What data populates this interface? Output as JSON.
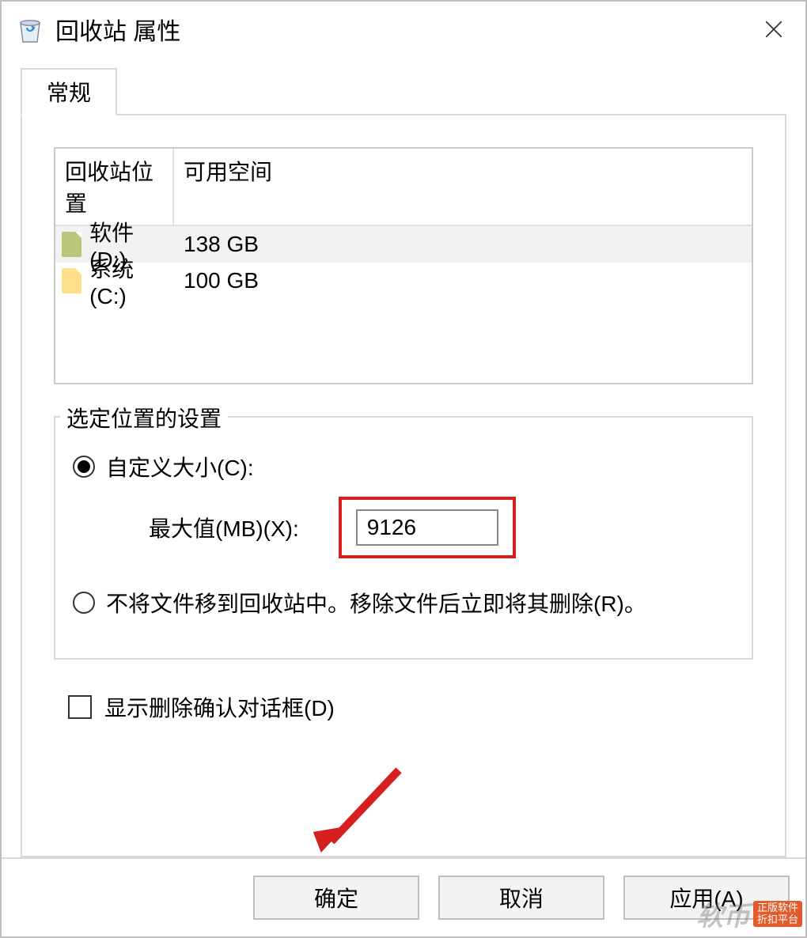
{
  "window": {
    "title": "回收站 属性"
  },
  "tabs": {
    "general": "常规"
  },
  "list": {
    "headers": {
      "location": "回收站位置",
      "space": "可用空间"
    },
    "rows": [
      {
        "icon": "green",
        "name": "软件 (D:)",
        "space": "138 GB",
        "selected": true
      },
      {
        "icon": "yellow",
        "name": "系统 (C:)",
        "space": "100 GB",
        "selected": false
      }
    ]
  },
  "group": {
    "title": "选定位置的设置",
    "custom_size": "自定义大小(C):",
    "max_label": "最大值(MB)(X):",
    "max_value": "9126",
    "no_recycle": "不将文件移到回收站中。移除文件后立即将其删除(R)。"
  },
  "confirm_checkbox": "显示删除确认对话框(D)",
  "buttons": {
    "ok": "确定",
    "cancel": "取消",
    "apply": "应用(A)"
  },
  "watermark": {
    "text": "软币",
    "badge1": "正版软件",
    "badge2": "折扣平台"
  },
  "highlight_color": "#d61f1f"
}
